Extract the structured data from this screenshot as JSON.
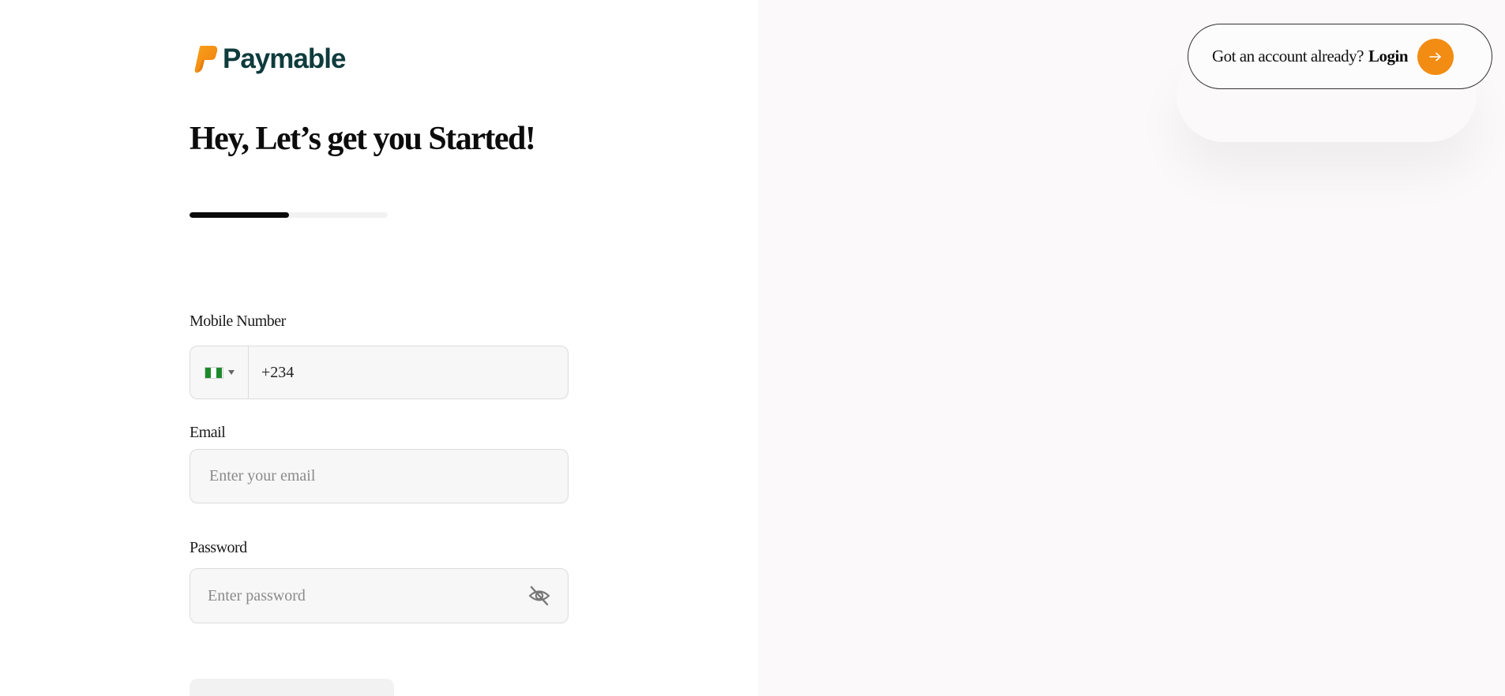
{
  "brand": {
    "name": "Paymable",
    "text_color": "#0f3b3c",
    "accent": "#f28c13"
  },
  "header": {
    "login_prompt": "Got an account already?",
    "login_link": "Login"
  },
  "main": {
    "title": "Hey, Let’s get you Started!",
    "progress": 0.5
  },
  "form": {
    "mobile": {
      "label": "Mobile Number",
      "country_flag": "nigeria-flag",
      "value": "+234"
    },
    "email": {
      "label": "Email",
      "placeholder": "Enter your email"
    },
    "password": {
      "label": "Password",
      "placeholder": "Enter password",
      "visibility_icon": "eye-off-icon"
    }
  }
}
